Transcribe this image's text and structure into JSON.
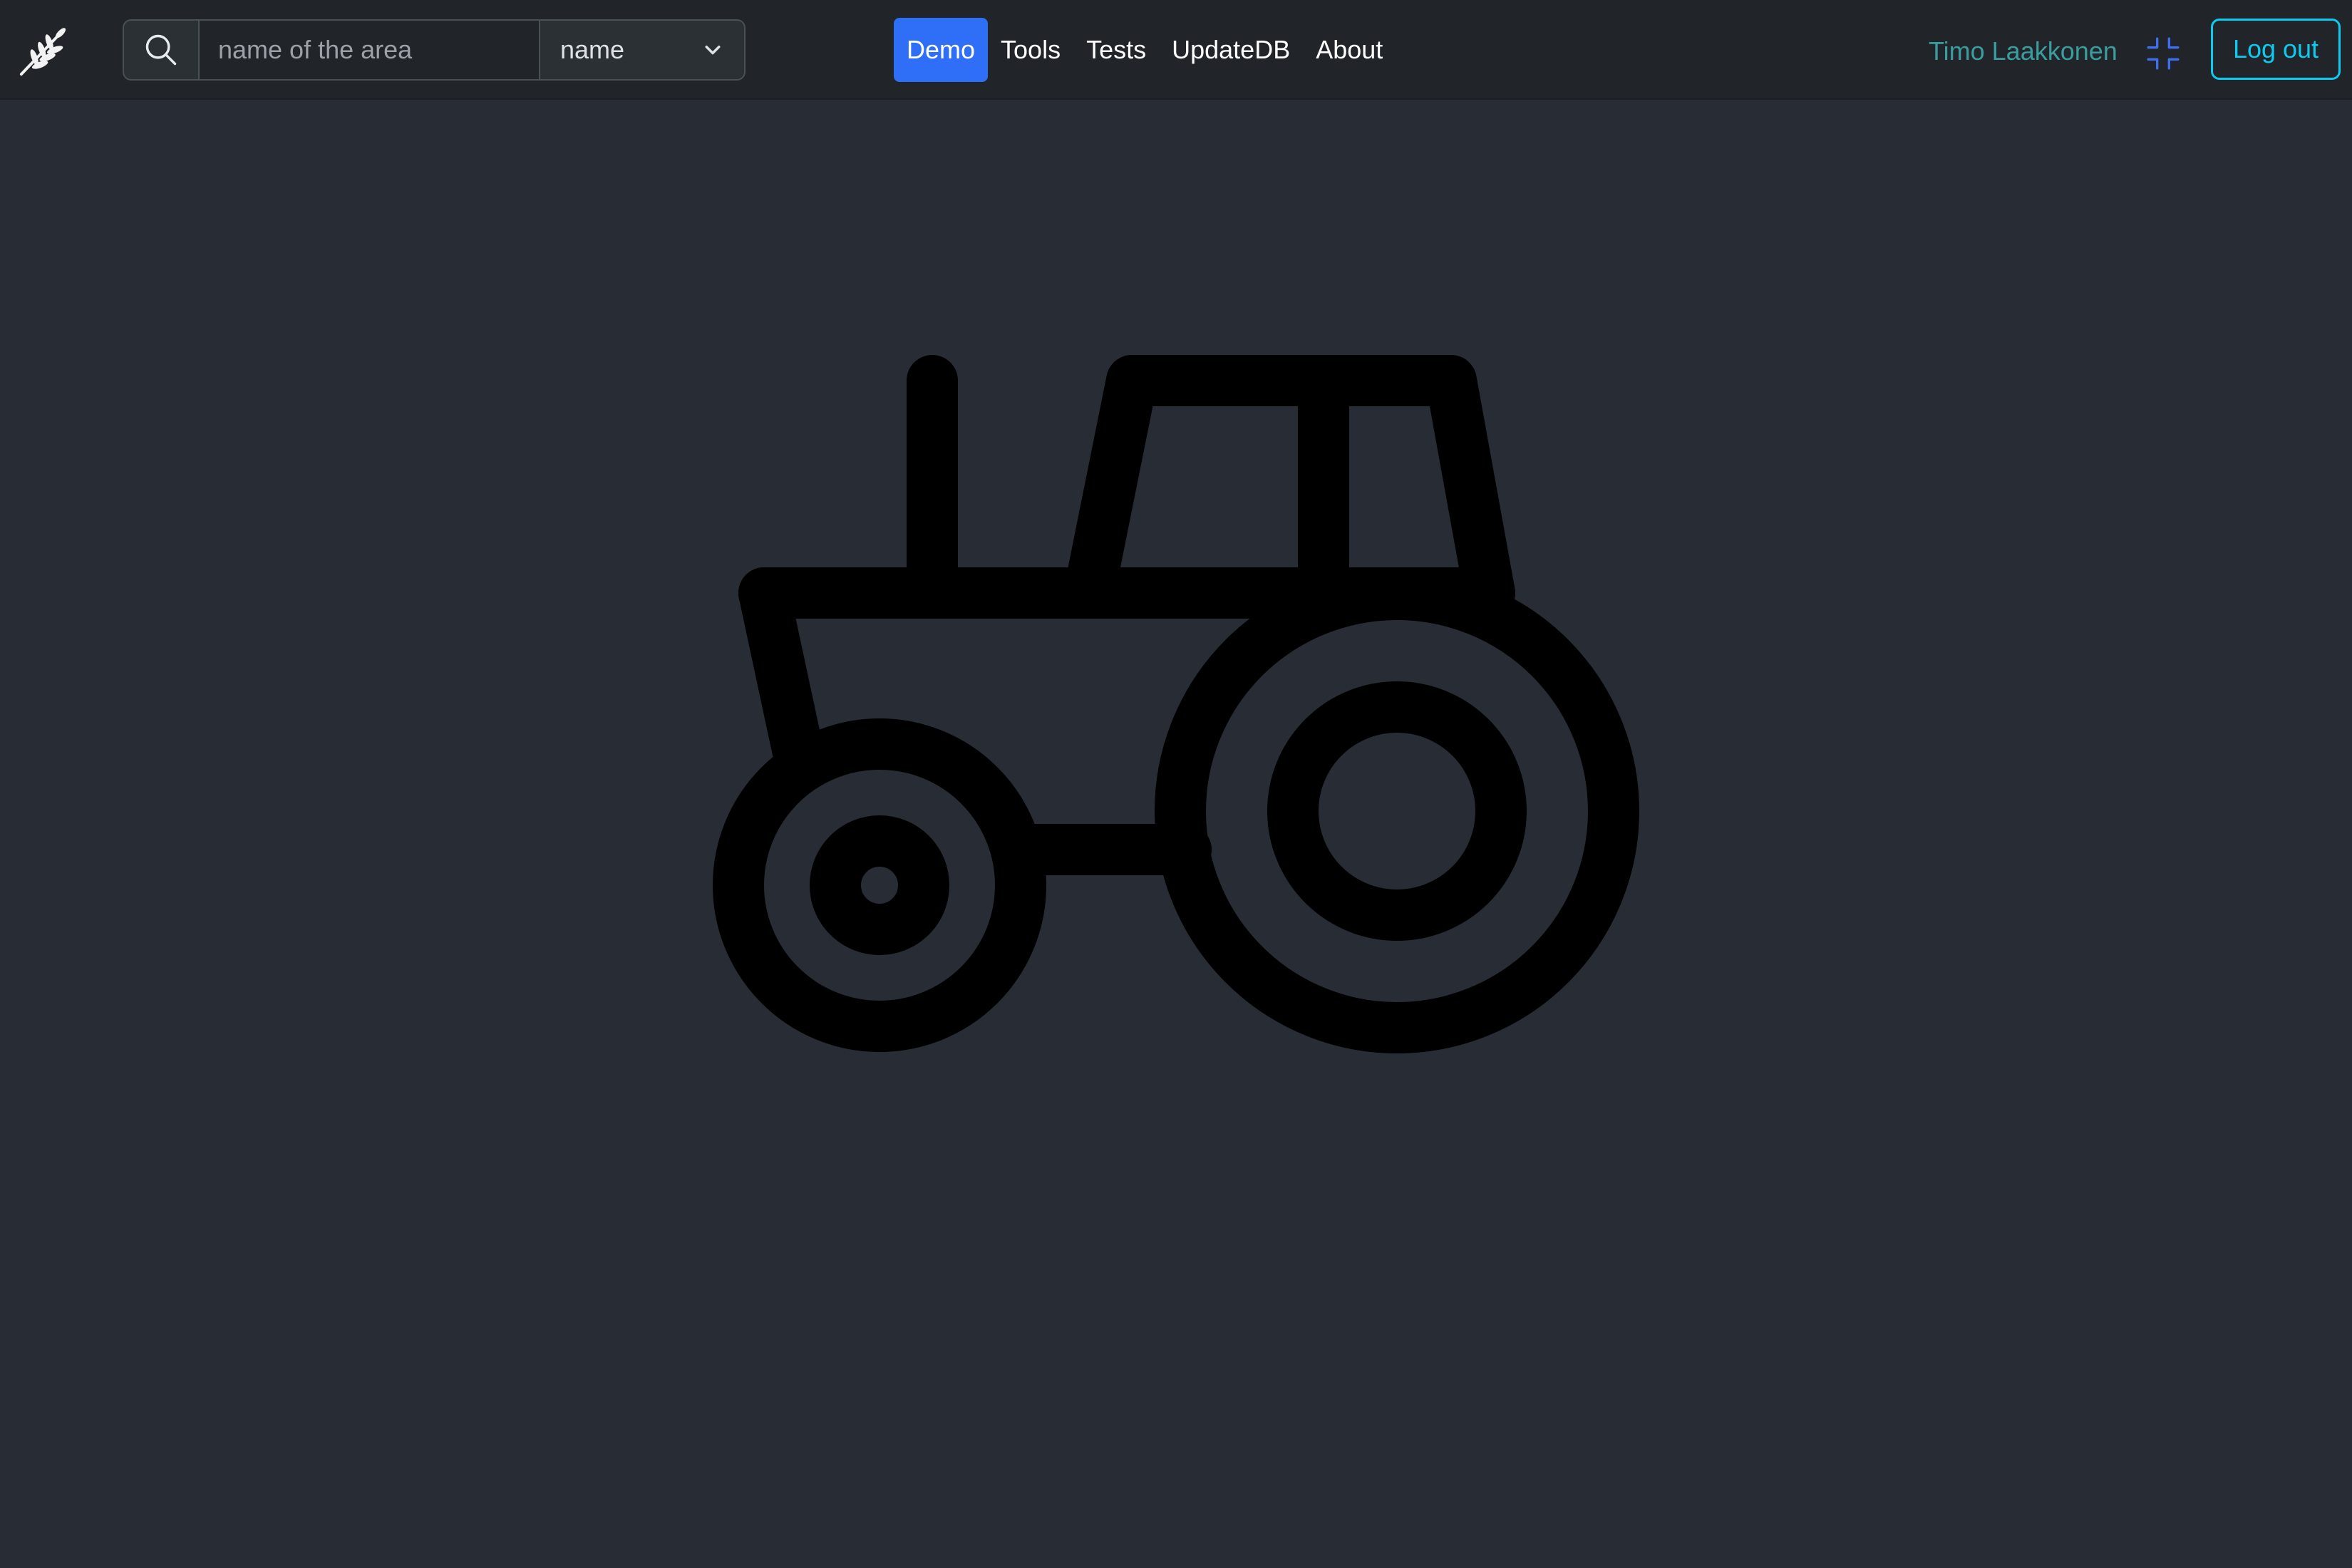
{
  "header": {
    "logo_icon": "wheat-icon",
    "search": {
      "icon": "search-icon",
      "placeholder": "name of the area",
      "value": ""
    },
    "search_mode": {
      "selected": "name",
      "icon": "chevron-down-icon"
    },
    "nav": {
      "items": [
        {
          "label": "Demo",
          "active": true
        },
        {
          "label": "Tools",
          "active": false
        },
        {
          "label": "Tests",
          "active": false
        },
        {
          "label": "UpdateDB",
          "active": false
        },
        {
          "label": "About",
          "active": false
        }
      ]
    },
    "user_name": "Timo Laakkonen",
    "fullscreen_icon": "fullscreen-exit-icon",
    "logout_label": "Log out"
  },
  "main": {
    "illustration_icon": "tractor-icon"
  },
  "colors": {
    "background": "#282c34",
    "navbar": "#212529",
    "accent": "#2f6ef6",
    "user_name": "#3a9da0",
    "logout": "#0dcaf0",
    "illustration": "#000000"
  }
}
